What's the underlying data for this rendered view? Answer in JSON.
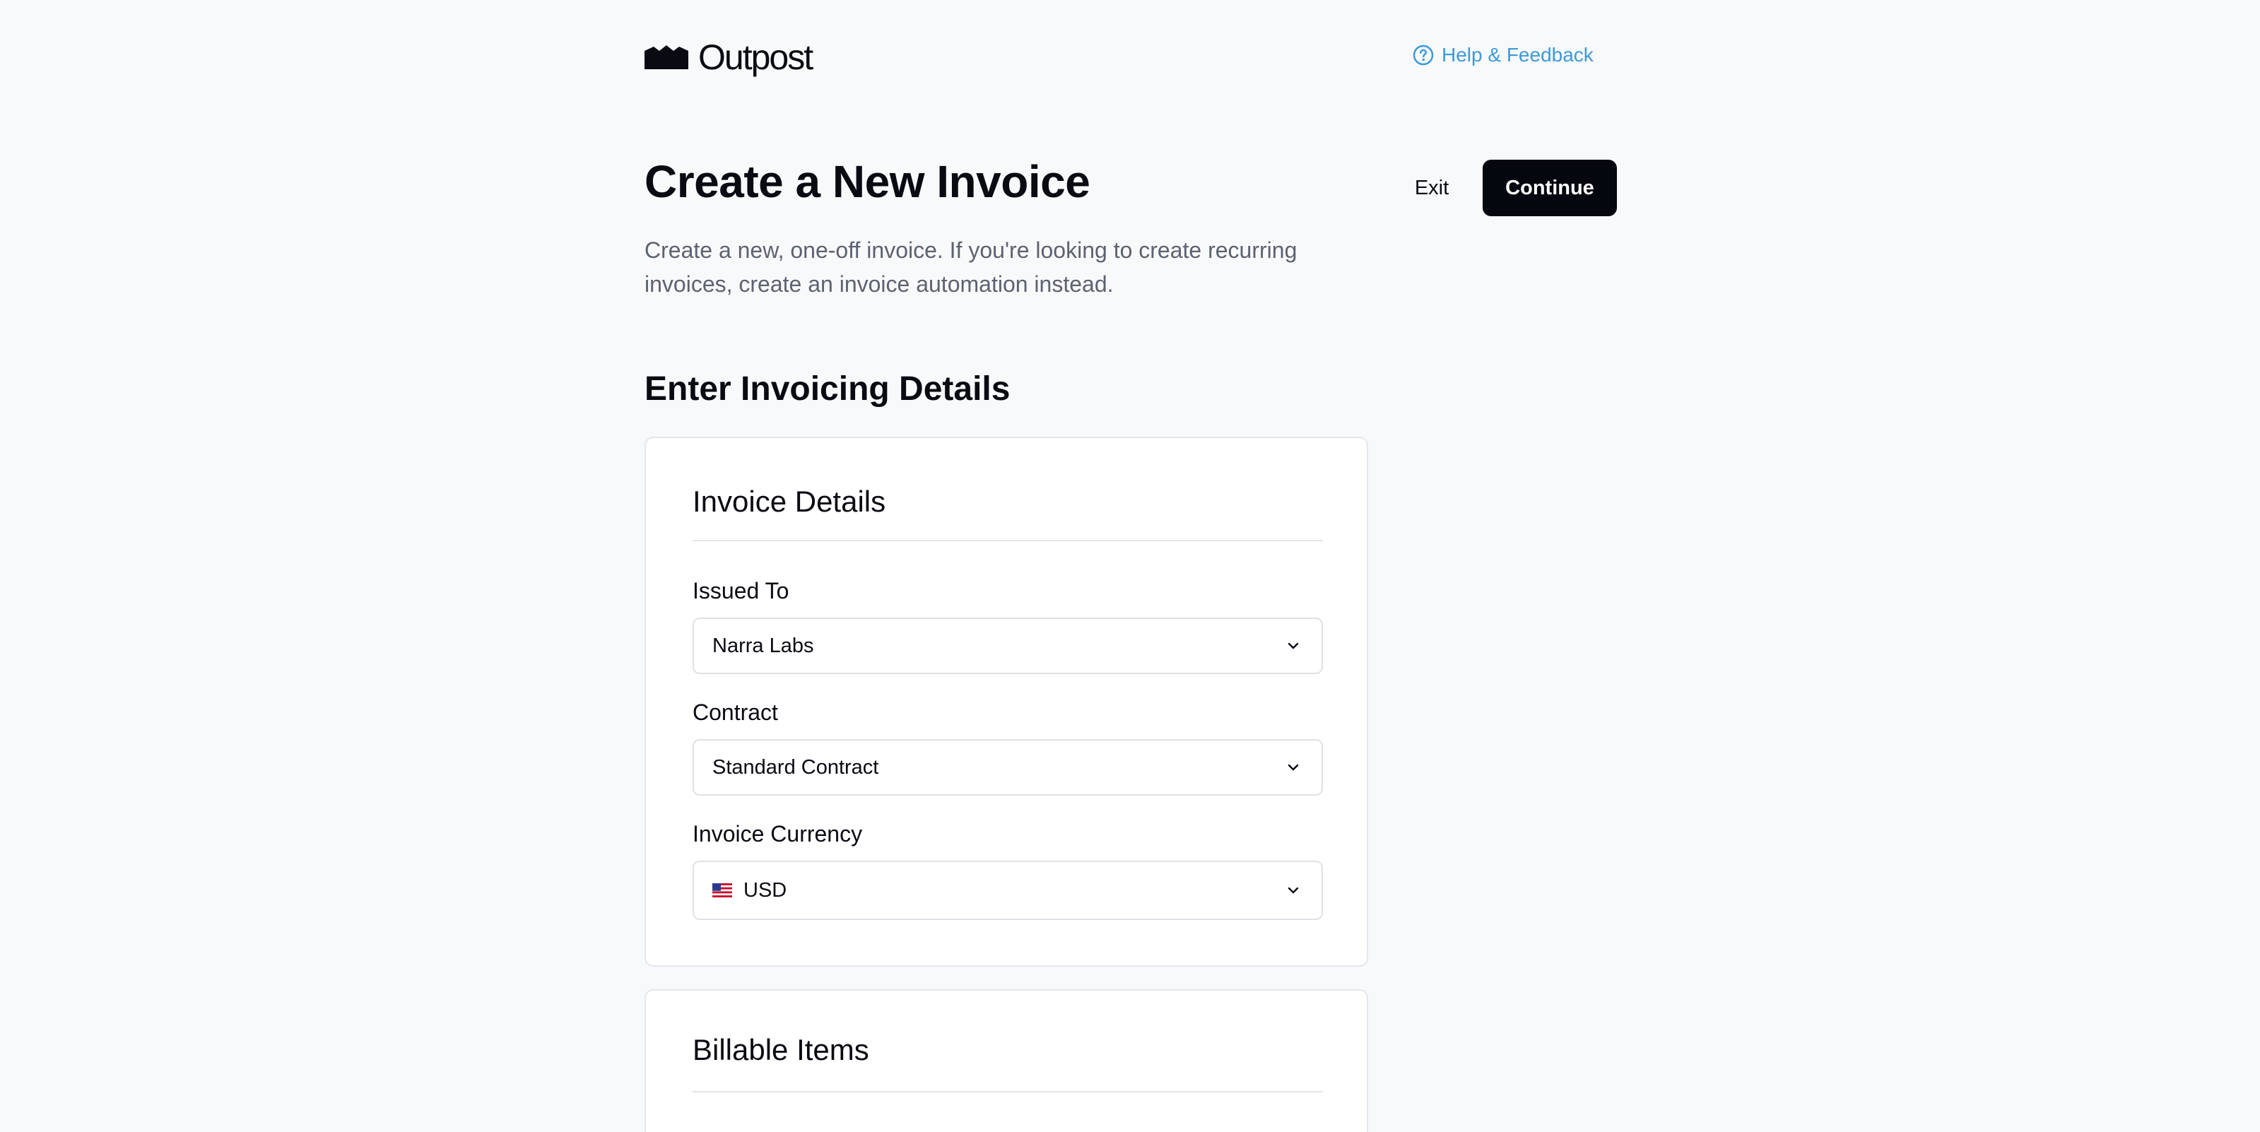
{
  "brand": {
    "name": "Outpost"
  },
  "header": {
    "help_label": "Help & Feedback",
    "help_icon": "question-circle-icon"
  },
  "page": {
    "title": "Create a New Invoice",
    "subtitle": "Create a new, one-off invoice. If you're looking to create recurring invoices, create an invoice automation instead.",
    "exit_label": "Exit",
    "continue_label": "Continue",
    "section_heading": "Enter Invoicing Details"
  },
  "invoice_details": {
    "title": "Invoice Details",
    "fields": [
      {
        "label": "Issued To",
        "value": "Narra Labs"
      },
      {
        "label": "Contract",
        "value": "Standard Contract"
      },
      {
        "label": "Invoice Currency",
        "value": "USD",
        "flag": "us-flag-icon"
      }
    ]
  },
  "billable_items": {
    "title": "Billable Items"
  },
  "colors": {
    "accent_link": "#3c9ad9",
    "primary_button": "#05070f",
    "background": "#f8f9fb"
  }
}
